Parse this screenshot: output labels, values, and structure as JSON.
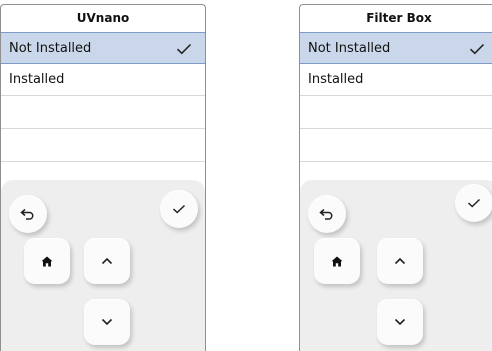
{
  "panels": [
    {
      "title": "UVnano",
      "options": [
        {
          "label": "Not Installed",
          "selected": true
        },
        {
          "label": "Installed",
          "selected": false
        }
      ]
    },
    {
      "title": "Filter Box",
      "options": [
        {
          "label": "Not Installed",
          "selected": true
        },
        {
          "label": "Installed",
          "selected": false
        }
      ]
    }
  ],
  "icons": {
    "selected_mark": "checkmark-icon",
    "back": "back-arrow-icon",
    "confirm": "checkmark-icon",
    "home": "home-icon",
    "up": "chevron-up-icon",
    "down": "chevron-down-icon"
  },
  "colors": {
    "selection_fill": "#cad7ea",
    "selection_border": "#7b9ac6",
    "pad_background": "#eeeeee"
  }
}
